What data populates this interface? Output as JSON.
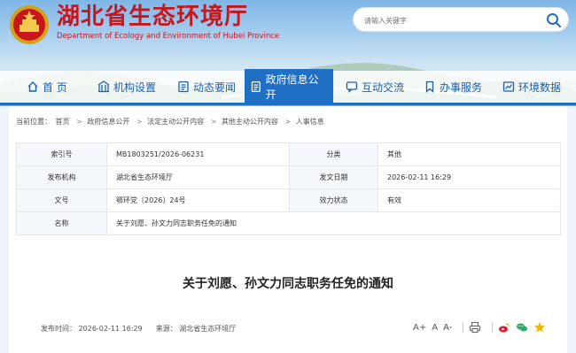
{
  "header": {
    "title": "湖北省生态环境厅",
    "subtitle": "Department of Ecology and Environment of Hubei Province",
    "search_placeholder": "请输入关键字"
  },
  "nav": {
    "items": [
      {
        "label": "首 页",
        "icon": "home-icon"
      },
      {
        "label": "机构设置",
        "icon": "building-icon"
      },
      {
        "label": "动态要闻",
        "icon": "news-icon"
      },
      {
        "label": "政府信息公开",
        "icon": "document-icon"
      },
      {
        "label": "互动交流",
        "icon": "chat-icon"
      },
      {
        "label": "办事服务",
        "icon": "bookmark-icon"
      },
      {
        "label": "环境数据",
        "icon": "data-icon"
      }
    ],
    "active_index": 3
  },
  "breadcrumb": {
    "prefix": "当前位置：",
    "items": [
      "首页",
      "政府信息公开",
      "法定主动公开内容",
      "其他主动公开内容",
      "人事信息"
    ],
    "separator": ">"
  },
  "meta": {
    "rows": [
      {
        "k1": "索引号",
        "v1": "MB1803251/2026-06231",
        "k2": "分类",
        "v2": "其他"
      },
      {
        "k1": "发布机构",
        "v1": "湖北省生态环境厅",
        "k2": "发文日期",
        "v2": "2026-02-11 16:29"
      },
      {
        "k1": "文号",
        "v1": "鄂环党〔2026〕24号",
        "k2": "效力状态",
        "v2": "有效"
      }
    ],
    "name_label": "名称",
    "name_value": "关于刘愿、孙文力同志职务任免的通知"
  },
  "article": {
    "title": "关于刘愿、孙文力同志职务任免的通知",
    "publish_label": "发布时间：",
    "publish_time": "2026-02-11 16:29",
    "source_label": "来源：",
    "source": "湖北省生态环境厅"
  },
  "tools": {
    "font_large": "A+",
    "font_normal": "A",
    "font_small": "A-"
  },
  "colors": {
    "brand_red": "#c8161d",
    "nav_blue": "#1f6fc5",
    "nav_text": "#1d5fae"
  }
}
